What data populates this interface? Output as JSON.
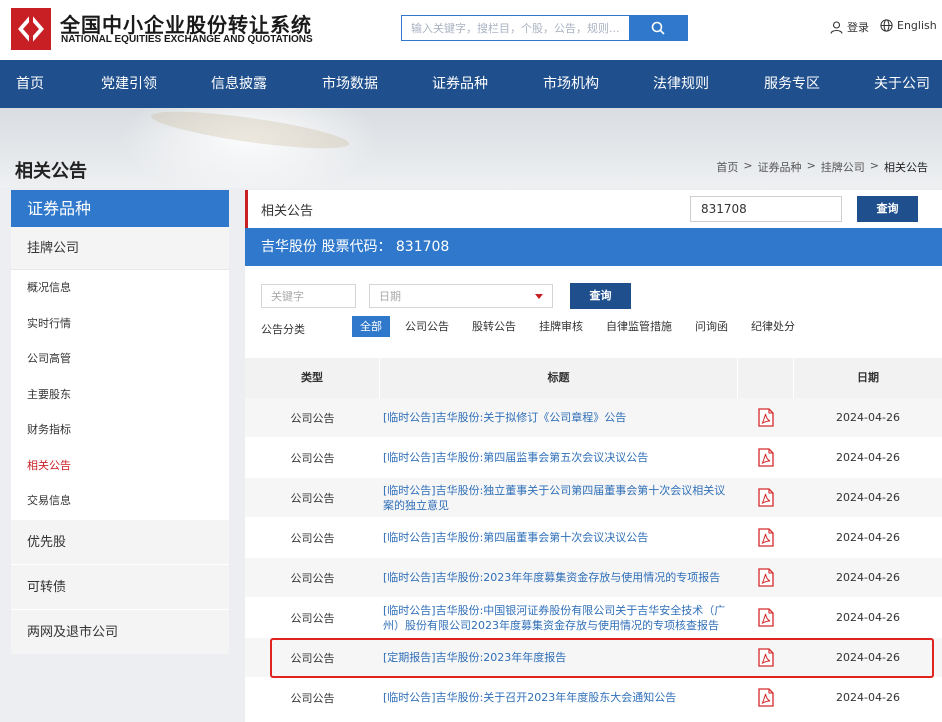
{
  "header": {
    "brand_cn": "全国中小企业股份转让系统",
    "brand_en": "NATIONAL EQUITIES EXCHANGE AND QUOTATIONS",
    "search_placeholder": "输入关键字，搜栏目，个股，公告，规则...",
    "login_label": "登录",
    "lang_label": "English"
  },
  "nav": [
    "首页",
    "党建引领",
    "信息披露",
    "市场数据",
    "证券品种",
    "市场机构",
    "法律规则",
    "服务专区",
    "关于公司"
  ],
  "page": {
    "title": "相关公告",
    "breadcrumb": [
      "首页",
      ">",
      "证券品种",
      ">",
      "挂牌公司",
      ">",
      "相关公告"
    ]
  },
  "sidebar": {
    "header": "证券品种",
    "group1": "挂牌公司",
    "items": [
      "概况信息",
      "实时行情",
      "公司高管",
      "主要股东",
      "财务指标",
      "相关公告",
      "交易信息"
    ],
    "active": "相关公告",
    "groups": [
      "优先股",
      "可转债",
      "两网及退市公司"
    ]
  },
  "main": {
    "section_title": "相关公告",
    "code_value": "831708",
    "query_label": "查询",
    "stock_label": "吉华股份  股票代码：  831708",
    "keyword_placeholder": "关键字",
    "date_placeholder": "日期",
    "filter_query_label": "查询",
    "category_label": "公告分类",
    "categories": [
      "全部",
      "公司公告",
      "股转公告",
      "挂牌审核",
      "自律监管措施",
      "问询函",
      "纪律处分"
    ],
    "active_category": "全部"
  },
  "table": {
    "headers": [
      "类型",
      "标题",
      "",
      "日期"
    ],
    "rows": [
      {
        "type": "公司公告",
        "title": "[临时公告]吉华股份:关于拟修订《公司章程》公告",
        "date": "2024-04-26"
      },
      {
        "type": "公司公告",
        "title": "[临时公告]吉华股份:第四届监事会第五次会议决议公告",
        "date": "2024-04-26"
      },
      {
        "type": "公司公告",
        "title": "[临时公告]吉华股份:独立董事关于公司第四届董事会第十次会议相关议案的独立意见",
        "date": "2024-04-26"
      },
      {
        "type": "公司公告",
        "title": "[临时公告]吉华股份:第四届董事会第十次会议决议公告",
        "date": "2024-04-26"
      },
      {
        "type": "公司公告",
        "title": "[临时公告]吉华股份:2023年年度募集资金存放与使用情况的专项报告",
        "date": "2024-04-26"
      },
      {
        "type": "公司公告",
        "title": "[临时公告]吉华股份:中国银河证券股份有限公司关于吉华安全技术（广州）股份有限公司2023年度募集资金存放与使用情况的专项核查报告",
        "date": "2024-04-26"
      },
      {
        "type": "公司公告",
        "title": "[定期报告]吉华股份:2023年年度报告",
        "date": "2024-04-26"
      },
      {
        "type": "公司公告",
        "title": "[临时公告]吉华股份:关于召开2023年年度股东大会通知公告",
        "date": "2024-04-26"
      }
    ]
  },
  "colors": {
    "nav_bg": "#1f4f8d",
    "accent_blue": "#2f78cb",
    "active_red": "#c81f25",
    "link_blue": "#2f6fb8",
    "highlight_red": "#e0231f"
  }
}
